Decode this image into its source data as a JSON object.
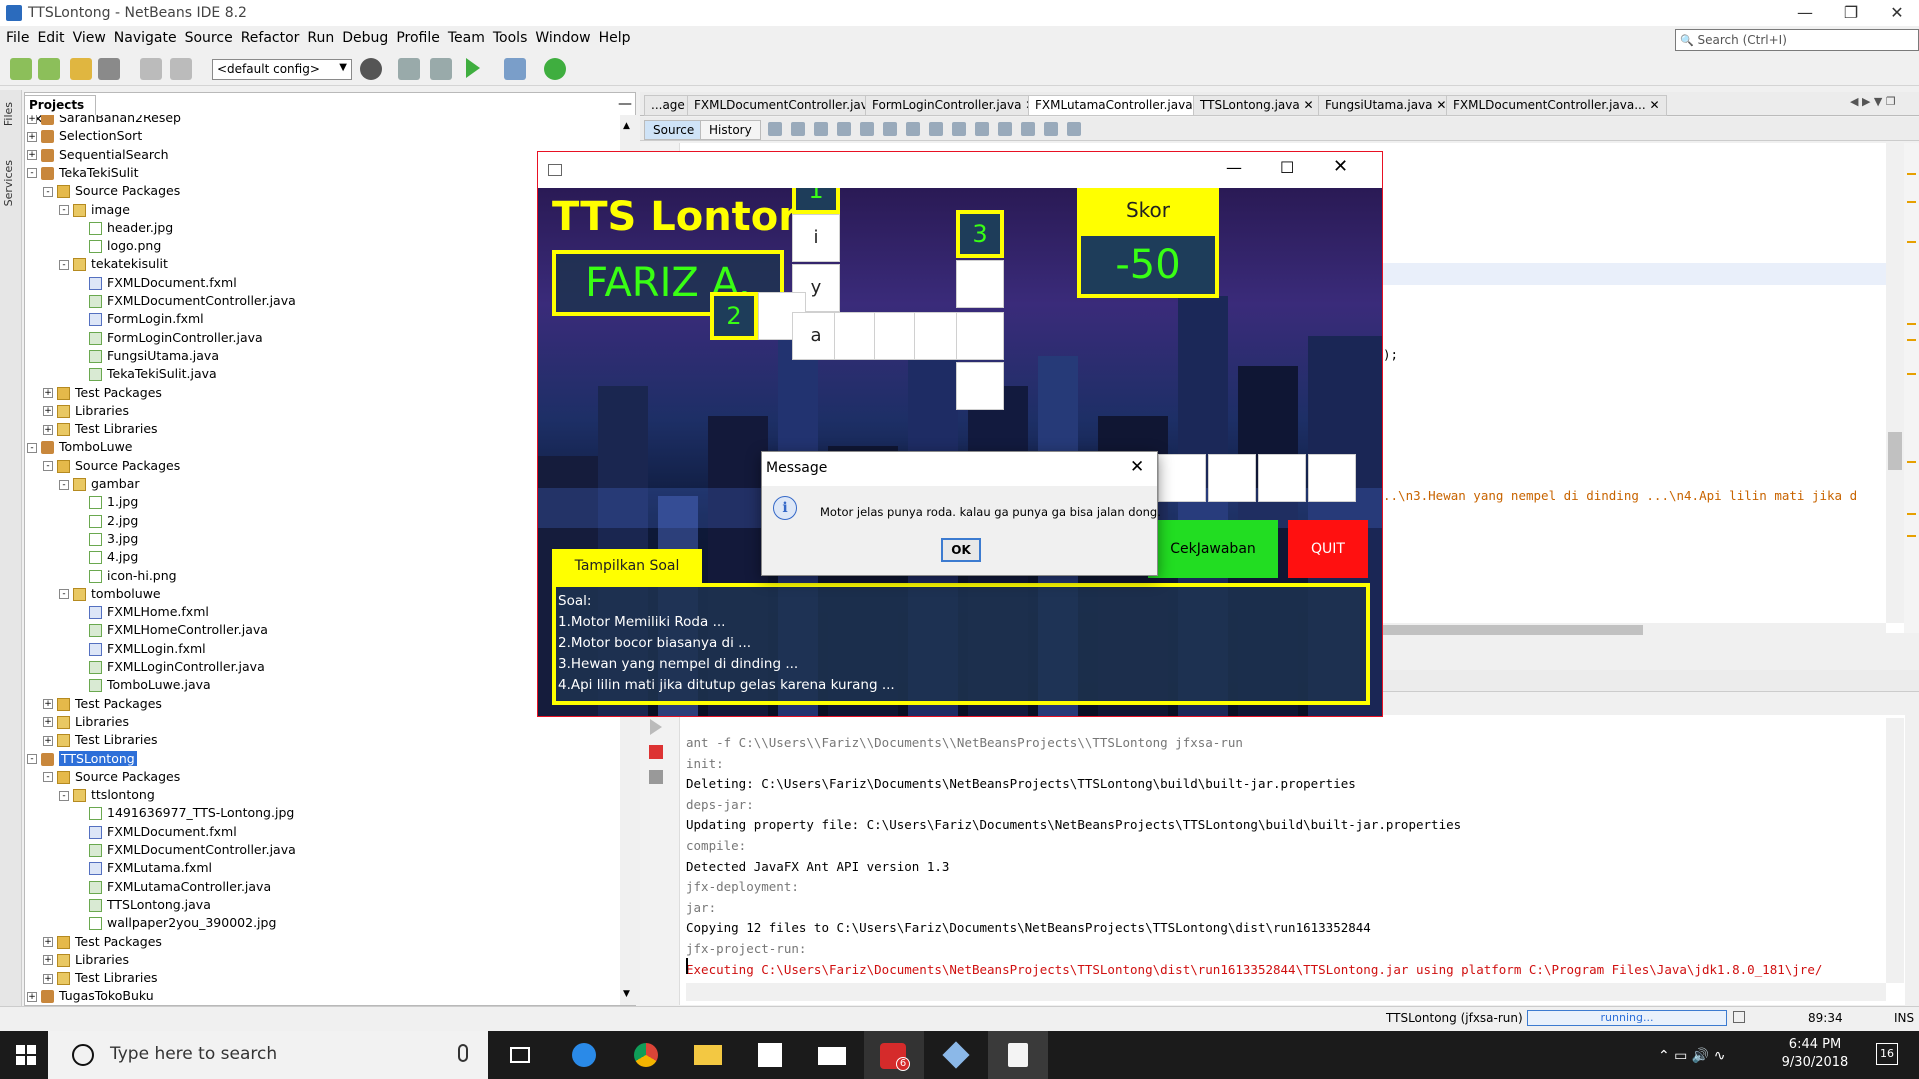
{
  "window": {
    "title": "TTSLontong - NetBeans IDE 8.2"
  },
  "menu": [
    "File",
    "Edit",
    "View",
    "Navigate",
    "Source",
    "Refactor",
    "Run",
    "Debug",
    "Profile",
    "Team",
    "Tools",
    "Window",
    "Help"
  ],
  "search": {
    "placeholder": "Search (Ctrl+I)"
  },
  "toolbar": {
    "config": "<default config>"
  },
  "side_tabs": {
    "files": "Files",
    "services": "Services"
  },
  "projects": {
    "tab": "Projects",
    "tree": [
      {
        "level": 0,
        "exp": "+",
        "icon": "proj",
        "label": "SaranBahan2Resep"
      },
      {
        "level": 0,
        "exp": "+",
        "icon": "proj",
        "label": "SelectionSort"
      },
      {
        "level": 0,
        "exp": "+",
        "icon": "proj",
        "label": "SequentialSearch"
      },
      {
        "level": 0,
        "exp": "-",
        "icon": "proj",
        "label": "TekaTekiSulit"
      },
      {
        "level": 1,
        "exp": "-",
        "icon": "pkg",
        "label": "Source Packages"
      },
      {
        "level": 2,
        "exp": "-",
        "icon": "folder",
        "label": "image"
      },
      {
        "level": 3,
        "exp": "",
        "icon": "file",
        "label": "header.jpg"
      },
      {
        "level": 3,
        "exp": "",
        "icon": "file",
        "label": "logo.png"
      },
      {
        "level": 2,
        "exp": "-",
        "icon": "folder",
        "label": "tekatekisulit"
      },
      {
        "level": 3,
        "exp": "",
        "icon": "fxml",
        "label": "FXMLDocument.fxml"
      },
      {
        "level": 3,
        "exp": "",
        "icon": "java",
        "label": "FXMLDocumentController.java"
      },
      {
        "level": 3,
        "exp": "",
        "icon": "fxml",
        "label": "FormLogin.fxml"
      },
      {
        "level": 3,
        "exp": "",
        "icon": "java",
        "label": "FormLoginController.java"
      },
      {
        "level": 3,
        "exp": "",
        "icon": "java",
        "label": "FungsiUtama.java"
      },
      {
        "level": 3,
        "exp": "",
        "icon": "java",
        "label": "TekaTekiSulit.java"
      },
      {
        "level": 1,
        "exp": "+",
        "icon": "pkg",
        "label": "Test Packages"
      },
      {
        "level": 1,
        "exp": "+",
        "icon": "folder",
        "label": "Libraries"
      },
      {
        "level": 1,
        "exp": "+",
        "icon": "folder",
        "label": "Test Libraries"
      },
      {
        "level": 0,
        "exp": "-",
        "icon": "proj",
        "label": "TomboLuwe"
      },
      {
        "level": 1,
        "exp": "-",
        "icon": "pkg",
        "label": "Source Packages"
      },
      {
        "level": 2,
        "exp": "-",
        "icon": "folder",
        "label": "gambar"
      },
      {
        "level": 3,
        "exp": "",
        "icon": "file",
        "label": "1.jpg"
      },
      {
        "level": 3,
        "exp": "",
        "icon": "file",
        "label": "2.jpg"
      },
      {
        "level": 3,
        "exp": "",
        "icon": "file",
        "label": "3.jpg"
      },
      {
        "level": 3,
        "exp": "",
        "icon": "file",
        "label": "4.jpg"
      },
      {
        "level": 3,
        "exp": "",
        "icon": "file",
        "label": "icon-hi.png"
      },
      {
        "level": 2,
        "exp": "-",
        "icon": "folder",
        "label": "tomboluwe"
      },
      {
        "level": 3,
        "exp": "",
        "icon": "fxml",
        "label": "FXMLHome.fxml"
      },
      {
        "level": 3,
        "exp": "",
        "icon": "java",
        "label": "FXMLHomeController.java"
      },
      {
        "level": 3,
        "exp": "",
        "icon": "fxml",
        "label": "FXMLLogin.fxml"
      },
      {
        "level": 3,
        "exp": "",
        "icon": "java",
        "label": "FXMLLoginController.java"
      },
      {
        "level": 3,
        "exp": "",
        "icon": "java",
        "label": "TomboLuwe.java"
      },
      {
        "level": 1,
        "exp": "+",
        "icon": "pkg",
        "label": "Test Packages"
      },
      {
        "level": 1,
        "exp": "+",
        "icon": "folder",
        "label": "Libraries"
      },
      {
        "level": 1,
        "exp": "+",
        "icon": "folder",
        "label": "Test Libraries"
      },
      {
        "level": 0,
        "exp": "-",
        "icon": "proj",
        "label": "TTSLontong",
        "selected": true
      },
      {
        "level": 1,
        "exp": "-",
        "icon": "pkg",
        "label": "Source Packages"
      },
      {
        "level": 2,
        "exp": "-",
        "icon": "folder",
        "label": "ttslontong"
      },
      {
        "level": 3,
        "exp": "",
        "icon": "file",
        "label": "1491636977_TTS-Lontong.jpg"
      },
      {
        "level": 3,
        "exp": "",
        "icon": "fxml",
        "label": "FXMLDocument.fxml"
      },
      {
        "level": 3,
        "exp": "",
        "icon": "java",
        "label": "FXMLDocumentController.java"
      },
      {
        "level": 3,
        "exp": "",
        "icon": "fxml",
        "label": "FXMLutama.fxml"
      },
      {
        "level": 3,
        "exp": "",
        "icon": "java",
        "label": "FXMLutamaController.java"
      },
      {
        "level": 3,
        "exp": "",
        "icon": "java",
        "label": "TTSLontong.java"
      },
      {
        "level": 3,
        "exp": "",
        "icon": "file",
        "label": "wallpaper2you_390002.jpg"
      },
      {
        "level": 1,
        "exp": "+",
        "icon": "pkg",
        "label": "Test Packages"
      },
      {
        "level": 1,
        "exp": "+",
        "icon": "folder",
        "label": "Libraries"
      },
      {
        "level": 1,
        "exp": "+",
        "icon": "folder",
        "label": "Test Libraries"
      },
      {
        "level": 0,
        "exp": "+",
        "icon": "proj",
        "label": "TugasTokoBuku"
      }
    ]
  },
  "editor": {
    "tabs": [
      "...age",
      "FXMLDocumentController.java",
      "FormLoginController.java",
      "FXMLutamaController.java",
      "TTSLontong.java",
      "FungsiUtama.java",
      "FXMLDocumentController.java..."
    ],
    "subtabs": [
      "Source",
      "History"
    ],
    "code_fragments": [
      ");",
      "..\\n3.Hewan yang nempel di dinding ...\\n4.Api lilin mati jika d"
    ]
  },
  "output": {
    "lines": [
      {
        "style": "grey",
        "text": "ant -f C:\\\\Users\\\\Fariz\\\\Documents\\\\NetBeansProjects\\\\TTSLontong jfxsa-run"
      },
      {
        "style": "grey",
        "text": "init:"
      },
      {
        "style": "",
        "text": "Deleting: C:\\Users\\Fariz\\Documents\\NetBeansProjects\\TTSLontong\\build\\built-jar.properties"
      },
      {
        "style": "grey",
        "text": "deps-jar:"
      },
      {
        "style": "",
        "text": "Updating property file: C:\\Users\\Fariz\\Documents\\NetBeansProjects\\TTSLontong\\build\\built-jar.properties"
      },
      {
        "style": "grey",
        "text": "compile:"
      },
      {
        "style": "",
        "text": "Detected JavaFX Ant API version 1.3"
      },
      {
        "style": "grey",
        "text": "jfx-deployment:"
      },
      {
        "style": "grey",
        "text": "jar:"
      },
      {
        "style": "",
        "text": "Copying 12 files to C:\\Users\\Fariz\\Documents\\NetBeansProjects\\TTSLontong\\dist\\run1613352844"
      },
      {
        "style": "grey",
        "text": "jfx-project-run:"
      },
      {
        "style": "red",
        "text": "Executing C:\\Users\\Fariz\\Documents\\NetBeansProjects\\TTSLontong\\dist\\run1613352844\\TTSLontong.jar using platform C:\\Program Files\\Java\\jdk1.8.0_181\\jre/"
      }
    ]
  },
  "status": {
    "task": "TTSLontong (jfxsa-run)",
    "progress": "running...",
    "position": "89:34",
    "mode": "INS"
  },
  "game": {
    "title": "TTS Lontong",
    "player": "FARIZ A.",
    "score_label": "Skor",
    "score": "-50",
    "numbers": [
      "1",
      "2",
      "3"
    ],
    "letters": [
      "i",
      "y",
      "a"
    ],
    "show_question_btn": "Tampilkan Soal",
    "check_btn": "CekJawaban",
    "quit_btn": "QUIT",
    "question_header": "Soal:",
    "questions": [
      "1.Motor Memiliki Roda ...",
      "2.Motor bocor biasanya di ...",
      "3.Hewan yang nempel di dinding ...",
      "4.Api lilin mati jika ditutup gelas karena kurang ..."
    ]
  },
  "dialog": {
    "title": "Message",
    "message": "Motor jelas punya roda. kalau ga punya ga bisa jalan dong.",
    "ok": "OK"
  },
  "taskbar": {
    "search_placeholder": "Type here to search",
    "time": "6:44 PM",
    "date": "9/30/2018",
    "notification_count": "16",
    "badge": "6"
  },
  "colors": {
    "accent_yellow": "#ffff00",
    "neon_green": "#39ff14",
    "quit_red": "#ff1010",
    "check_green": "#22dd22",
    "selection_blue": "#2d6fd8"
  }
}
